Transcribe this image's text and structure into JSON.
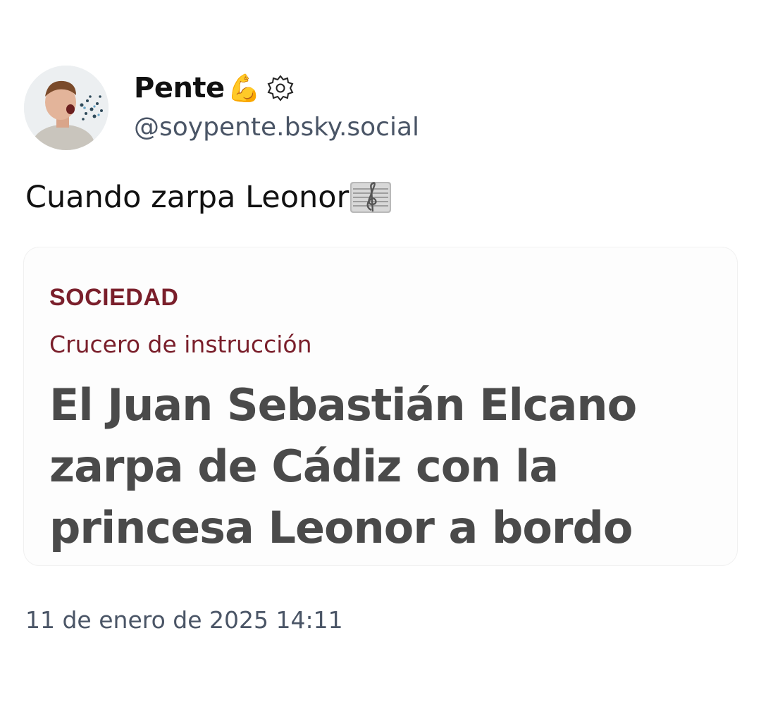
{
  "author": {
    "display_name": "Pente",
    "name_emoji": "💪",
    "handle": "@soypente.bsky.social"
  },
  "post": {
    "text": "Cuando zarpa Leonor",
    "timestamp": "11 de enero de 2025 14:11"
  },
  "embed": {
    "section": "SOCIEDAD",
    "kicker": "Crucero de instrucción",
    "headline": "El Juan Sebastián Elcano zarpa de Cádiz con la princesa Leonor a bordo"
  },
  "icons": {
    "avatar": "avatar-photo",
    "badge": "verified-badge-icon",
    "music": "musical-score-icon"
  },
  "colors": {
    "section_red": "#7a1f2b",
    "headline_gray": "#4a4a4a",
    "meta_gray": "#4a5566"
  }
}
